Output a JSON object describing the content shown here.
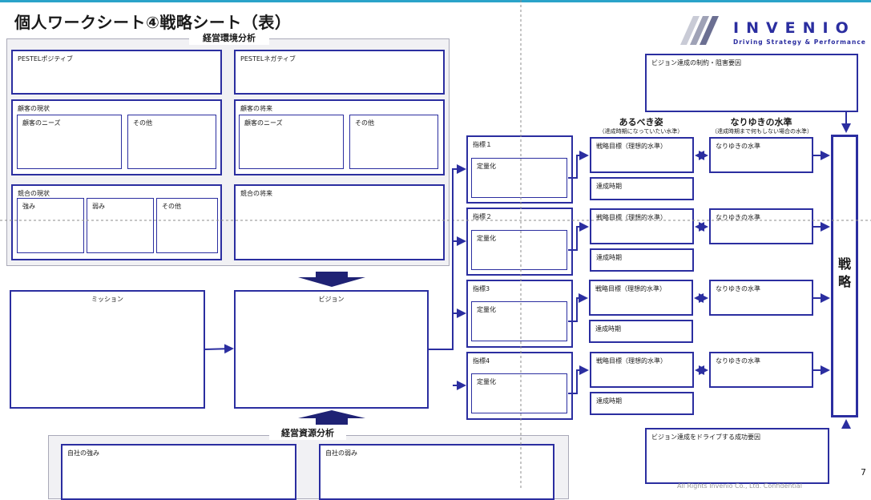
{
  "title": "個人ワークシート④戦略シート（表）",
  "brand": {
    "name": "INVENIO",
    "tagline": "Driving Strategy & Performance",
    "color": "#2b2ea0"
  },
  "page_number": "7",
  "footer_faint": "All Rights Invenio Co., Ltd. Confidential",
  "environment": {
    "header": "経営環境分析",
    "pestel_positive": "PESTELポジティブ",
    "pestel_negative": "PESTELネガティブ",
    "customer_current": {
      "title": "顧客の現状",
      "needs": "顧客のニーズ",
      "other": "その他"
    },
    "customer_future": {
      "title": "顧客の将来",
      "needs": "顧客のニーズ",
      "other": "その他"
    },
    "competition_current": {
      "title": "競合の現状",
      "strengths": "強み",
      "weaknesses": "弱み",
      "other": "その他"
    },
    "competition_future": {
      "title": "競合の将来"
    }
  },
  "mission": "ミッション",
  "vision": "ビジョン",
  "resources": {
    "header": "経営資源分析",
    "strengths": "自社の強み",
    "weaknesses": "自社の弱み"
  },
  "constraints": "ビジョン達成の制約・阻害要因",
  "success_factors": "ビジョン達成をドライブする成功要因",
  "ideal": {
    "title": "あるべき姿",
    "subtitle": "（達成時期になっていたい水準）"
  },
  "trend": {
    "title": "なりゆきの水準",
    "subtitle": "（達成時期まで何もしない場合の水準）"
  },
  "indicators": [
    {
      "label": "指標１",
      "quant": "定量化",
      "goal": "戦略目標（理想的水準）",
      "deadline": "達成時期",
      "trend": "なりゆきの水準"
    },
    {
      "label": "指標２",
      "quant": "定量化",
      "goal": "戦略目標（理想的水準）",
      "deadline": "達成時期",
      "trend": "なりゆきの水準"
    },
    {
      "label": "指標3",
      "quant": "定量化",
      "goal": "戦略目標（理想的水準）",
      "deadline": "達成時期",
      "trend": "なりゆきの水準"
    },
    {
      "label": "指標4",
      "quant": "定量化",
      "goal": "戦略目標（理想的水準）",
      "deadline": "達成時期",
      "trend": "なりゆきの水準"
    }
  ],
  "strategy": "戦略"
}
